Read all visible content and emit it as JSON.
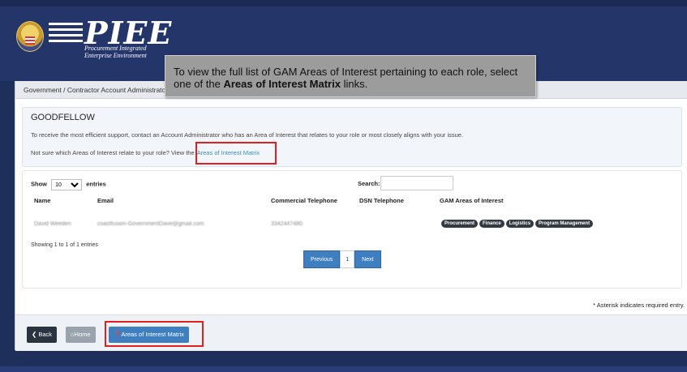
{
  "header": {
    "logo_title": "PIEE",
    "logo_sub_1": "Procurement Integrated",
    "logo_sub_2": "Enterprise Environment"
  },
  "tooltip": {
    "text_before": "To view the full list of GAM Areas of Interest pertaining to each role, select one of the ",
    "bold": "Areas of Interest Matrix",
    "text_after": " links."
  },
  "breadcrumb": "Government / Contractor Account Administrator",
  "goodfellow": {
    "title": "GOODFELLOW",
    "line1": "To receive the most efficient support, contact an Account Administrator who has an Area of Interest that relates to your role or most closely aligns with your issue.",
    "line2": "Not sure which Areas of Interest relate to your role? View the",
    "link": "Areas of Interest Matrix"
  },
  "table": {
    "show_label": "Show",
    "entries_value": "10",
    "entries_label": "entries",
    "search_label": "Search:",
    "columns": [
      "Name",
      "Email",
      "Commercial Telephone",
      "DSN Telephone",
      "GAM Areas of Interest"
    ],
    "rows": [
      {
        "name": "David Weeden",
        "email": "coastfusion-GovernmentDave@gmail.com",
        "phone": "3342447480",
        "dsn": "",
        "areas": [
          "Procurement",
          "Finance",
          "Logistics",
          "Program Management"
        ]
      }
    ],
    "showing": "Showing 1 to 1 of 1 entries",
    "pager": {
      "previous": "Previous",
      "page": "1",
      "next": "Next"
    }
  },
  "asterisk_note": "* Asterisk indicates required entry.",
  "footer": {
    "back": "Back",
    "home": "Home",
    "aoi_matrix": "Areas of Interest Matrix"
  }
}
